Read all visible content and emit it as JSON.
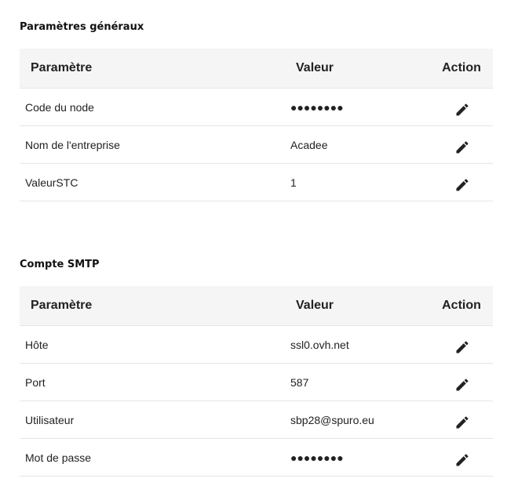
{
  "sections": [
    {
      "title": "Paramètres généraux",
      "headers": {
        "param": "Paramètre",
        "value": "Valeur",
        "action": "Action"
      },
      "rows": [
        {
          "param": "Code du node",
          "value": "●●●●●●●●",
          "action_icon": "edit-icon"
        },
        {
          "param": "Nom de l'entreprise",
          "value": "Acadee",
          "action_icon": "edit-icon"
        },
        {
          "param": "ValeurSTC",
          "value": "1",
          "action_icon": "edit-icon"
        }
      ]
    },
    {
      "title": "Compte SMTP",
      "headers": {
        "param": "Paramètre",
        "value": "Valeur",
        "action": "Action"
      },
      "rows": [
        {
          "param": "Hôte",
          "value": "ssl0.ovh.net",
          "action_icon": "edit-icon"
        },
        {
          "param": "Port",
          "value": "587",
          "action_icon": "edit-icon"
        },
        {
          "param": "Utilisateur",
          "value": "sbp28@spuro.eu",
          "action_icon": "edit-icon"
        },
        {
          "param": "Mot de passe",
          "value": "●●●●●●●●",
          "action_icon": "edit-icon"
        }
      ]
    }
  ],
  "colors": {
    "header_bg": "#f5f5f5",
    "row_border": "#e6e6e6",
    "text": "#222222",
    "icon": "#222222"
  }
}
